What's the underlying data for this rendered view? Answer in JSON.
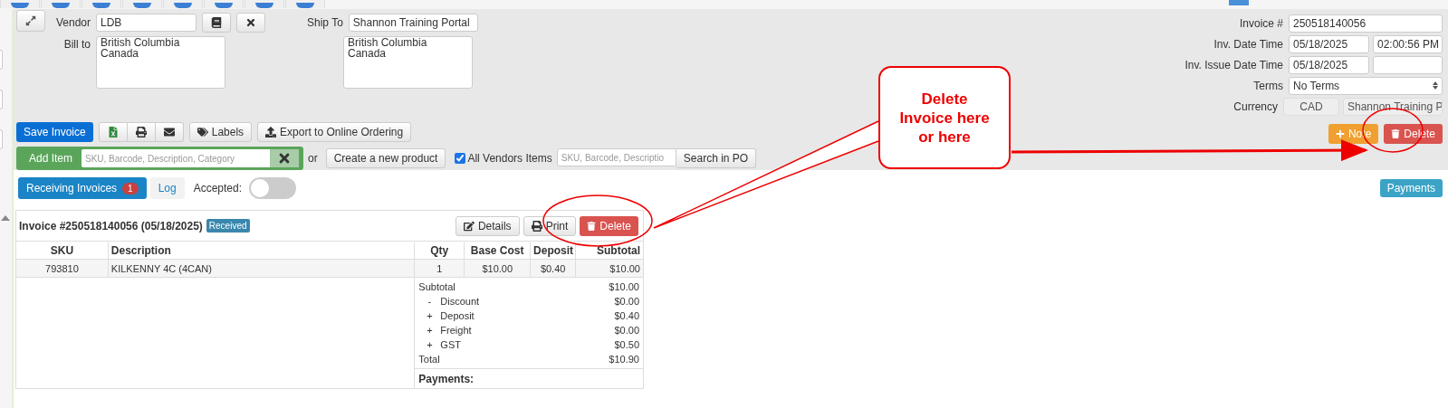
{
  "vendor": {
    "label": "Vendor",
    "value": "LDB"
  },
  "bill_to": {
    "label": "Bill to",
    "value": "British Columbia\nCanada"
  },
  "ship_to": {
    "label": "Ship To",
    "value": "Shannon Training Portal",
    "address": "British Columbia\nCanada"
  },
  "invoice_fields": [
    {
      "label": "Invoice #",
      "kind": "text",
      "values": [
        "250518140056"
      ]
    },
    {
      "label": "Inv. Date Time",
      "kind": "pair",
      "values": [
        "05/18/2025",
        "02:00:56 PM"
      ]
    },
    {
      "label": "Inv. Issue Date Time",
      "kind": "pair",
      "values": [
        "05/18/2025"
      ]
    },
    {
      "label": "Terms",
      "kind": "select",
      "values": [
        "No Terms"
      ]
    },
    {
      "label": "Currency",
      "kind": "readonly",
      "values": [
        "CAD",
        "Shannon Training P"
      ]
    }
  ],
  "toolbar": {
    "save": "Save Invoice",
    "labels": "Labels",
    "export": "Export to Online Ordering"
  },
  "add_item": {
    "label": "Add Item",
    "placeholder": "SKU, Barcode, Description, Category",
    "or": "or",
    "create": "Create a new product",
    "all_vendors": {
      "label": "All Vendors Items",
      "checked": true
    },
    "po_placeholder": "SKU, Barcode, Descriptio",
    "po_search": "Search in PO"
  },
  "header_buttons": {
    "note": "Note",
    "delete": "Delete"
  },
  "tabs": [
    {
      "label": "Receiving Invoices",
      "badge": "1",
      "selected": true
    },
    {
      "label": "Log",
      "selected": false
    }
  ],
  "accepted": {
    "label": "Accepted:",
    "on": false
  },
  "payments_button": "Payments",
  "invoice": {
    "title": "Invoice #250518140056 (05/18/2025)",
    "status": "Received",
    "buttons": {
      "details": "Details",
      "print": "Print",
      "delete": "Delete"
    },
    "columns": [
      "SKU",
      "Description",
      "Qty",
      "Base Cost",
      "Deposit",
      "Subtotal"
    ],
    "rows": [
      [
        "793810",
        "KILKENNY 4C (4CAN)",
        "1",
        "$10.00",
        "$0.40",
        "$10.00"
      ]
    ],
    "totals": [
      {
        "label": "Subtotal",
        "amount": "$10.00"
      },
      {
        "sign": "-",
        "label": "Discount",
        "amount": "$0.00"
      },
      {
        "sign": "+",
        "label": "Deposit",
        "amount": "$0.40"
      },
      {
        "sign": "+",
        "label": "Freight",
        "amount": "$0.00"
      },
      {
        "sign": "+",
        "label": "GST",
        "amount": "$0.50"
      },
      {
        "label": "Total",
        "amount": "$10.90"
      }
    ],
    "payments_label": "Payments:"
  },
  "annotation": {
    "text": "Delete\nInvoice here\nor here"
  }
}
